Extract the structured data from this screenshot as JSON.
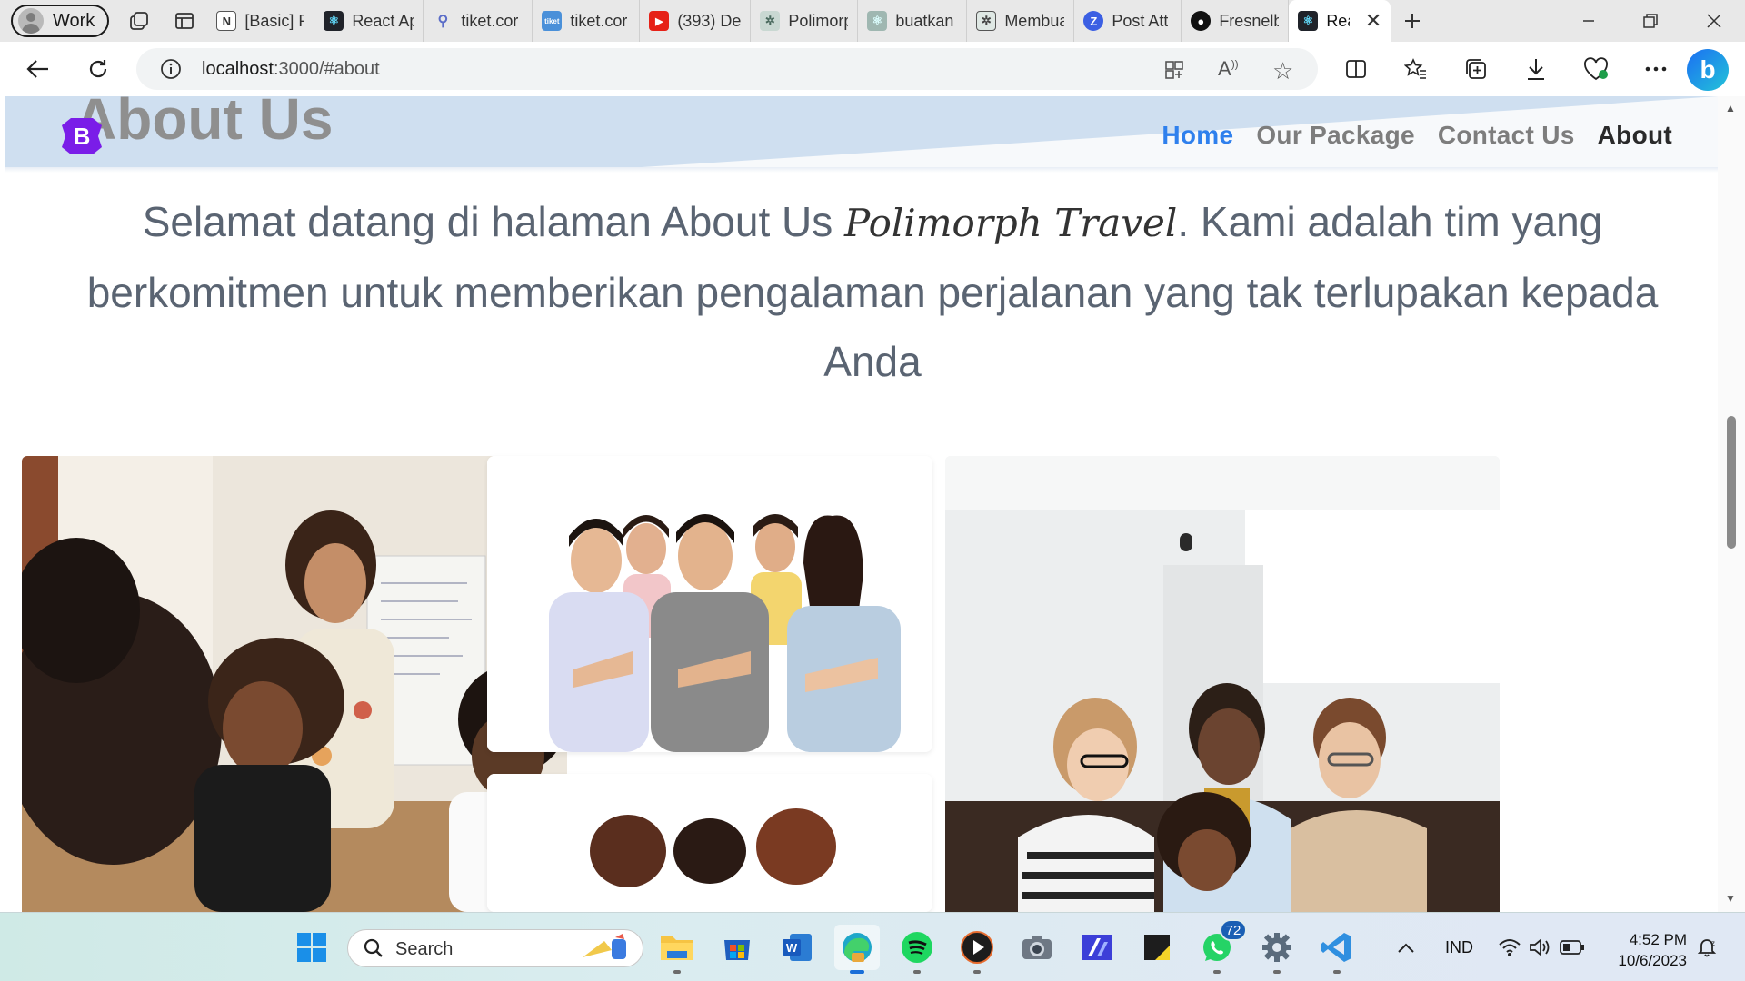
{
  "browser": {
    "profile_label": "Work",
    "tabs": [
      {
        "label": "[Basic] P",
        "icon": "notion-icon"
      },
      {
        "label": "React Ap",
        "icon": "react-icon"
      },
      {
        "label": "tiket.cor",
        "icon": "search-icon"
      },
      {
        "label": "tiket.cor",
        "icon": "tiket-icon"
      },
      {
        "label": "(393) De",
        "icon": "youtube-icon"
      },
      {
        "label": "Polimorp",
        "icon": "chatgpt-icon"
      },
      {
        "label": "buatkan",
        "icon": "react-icon"
      },
      {
        "label": "Membua",
        "icon": "chatgpt-icon"
      },
      {
        "label": "Post Att",
        "icon": "zotero-icon"
      },
      {
        "label": "Fresnelb",
        "icon": "github-icon"
      },
      {
        "label": "Rea",
        "icon": "react-icon"
      }
    ],
    "address": {
      "host": "localhost",
      "path": ":3000/#about"
    }
  },
  "site": {
    "hero_title": "About Us",
    "brand_letter": "B",
    "nav": {
      "home": "Home",
      "package": "Our Package",
      "contact": "Contact Us",
      "about": "About"
    },
    "intro": {
      "before": "Selamat datang di halaman About Us ",
      "brand": "Polimorph Travel",
      "after": ". Kami adalah tim yang berkomitmen untuk memberikan pengalaman perjalanan yang tak terlupakan kepada Anda"
    },
    "images": [
      {
        "name": "team-classroom-photo"
      },
      {
        "name": "team-group-photo"
      },
      {
        "name": "team-meeting-photo"
      },
      {
        "name": "team-photo-partial"
      }
    ]
  },
  "taskbar": {
    "search_placeholder": "Search",
    "whatsapp_badge": "72",
    "language": "IND",
    "time": "4:52 PM",
    "date": "10/6/2023"
  },
  "colors": {
    "nav_bg": "#cfdff0",
    "nav_active": "#2f80ed",
    "brand_purple": "#7a1de8"
  }
}
